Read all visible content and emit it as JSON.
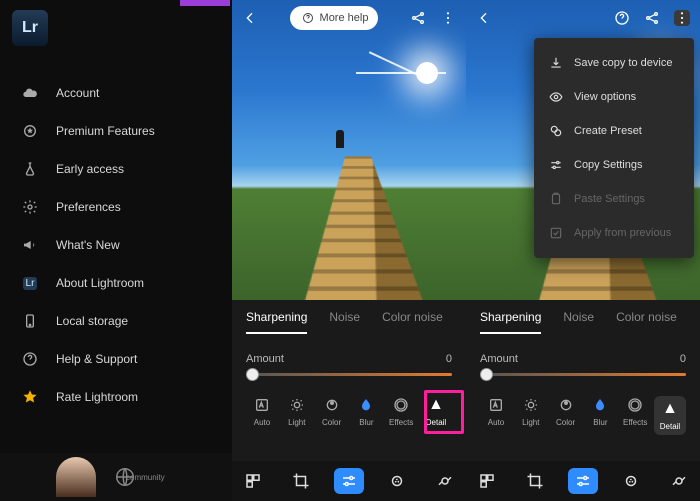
{
  "logo_text": "Lr",
  "menu": {
    "items": [
      {
        "icon": "cloud",
        "label": "Account"
      },
      {
        "icon": "star-outline",
        "label": "Premium Features"
      },
      {
        "icon": "flask",
        "label": "Early access"
      },
      {
        "icon": "gear",
        "label": "Preferences"
      },
      {
        "icon": "megaphone",
        "label": "What's New"
      },
      {
        "icon": "lr-badge",
        "label": "About Lightroom"
      },
      {
        "icon": "phone",
        "label": "Local storage"
      },
      {
        "icon": "help",
        "label": "Help & Support"
      },
      {
        "icon": "star-filled",
        "label": "Rate Lightroom"
      }
    ]
  },
  "footer": {
    "community": "community"
  },
  "editor": {
    "more_help": "More help",
    "tabs": [
      "Sharpening",
      "Noise",
      "Color noise"
    ],
    "active_tab_index": 0,
    "slider": {
      "label": "Amount",
      "value": "0"
    },
    "tools": [
      {
        "key": "auto",
        "label": "Auto"
      },
      {
        "key": "light",
        "label": "Light"
      },
      {
        "key": "color",
        "label": "Color"
      },
      {
        "key": "blur",
        "label": "Blur"
      },
      {
        "key": "effects",
        "label": "Effects"
      },
      {
        "key": "detail",
        "label": "Detail"
      }
    ]
  },
  "dropdown": {
    "items": [
      {
        "icon": "download",
        "label": "Save copy to device",
        "enabled": true
      },
      {
        "icon": "eye",
        "label": "View options",
        "enabled": true
      },
      {
        "icon": "preset",
        "label": "Create Preset",
        "enabled": true
      },
      {
        "icon": "copy",
        "label": "Copy Settings",
        "enabled": true
      },
      {
        "icon": "paste",
        "label": "Paste Settings",
        "enabled": false
      },
      {
        "icon": "apply",
        "label": "Apply from previous",
        "enabled": false
      }
    ]
  }
}
